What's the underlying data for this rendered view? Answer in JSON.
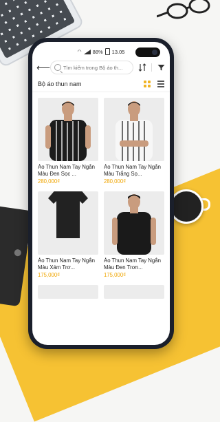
{
  "status_bar": {
    "battery": "88%",
    "time": "13.05"
  },
  "search": {
    "placeholder": "Tìm kiếm trong Bộ áo th..."
  },
  "category": {
    "title": "Bộ áo thun nam"
  },
  "colors": {
    "accent": "#f0b323",
    "price": "#f0a500"
  },
  "products": [
    {
      "name": "Áo Thun Nam Tay Ngắn Màu Đen Sọc ...",
      "price": "280,000₫",
      "image": "black-striped-tee"
    },
    {
      "name": "Áo Thun Nam Tay Ngắn Màu Trắng Sọ...",
      "price": "280,000₫",
      "image": "white-striped-tee"
    },
    {
      "name": "Áo Thun Nam Tay Ngắn Màu Xám Trơ...",
      "price": "175,000₫",
      "image": "plain-black-tee"
    },
    {
      "name": "Áo Thun Nam Tay Ngắn Màu Đen Trơn...",
      "price": "175,000₫",
      "image": "black-tee-model"
    }
  ]
}
